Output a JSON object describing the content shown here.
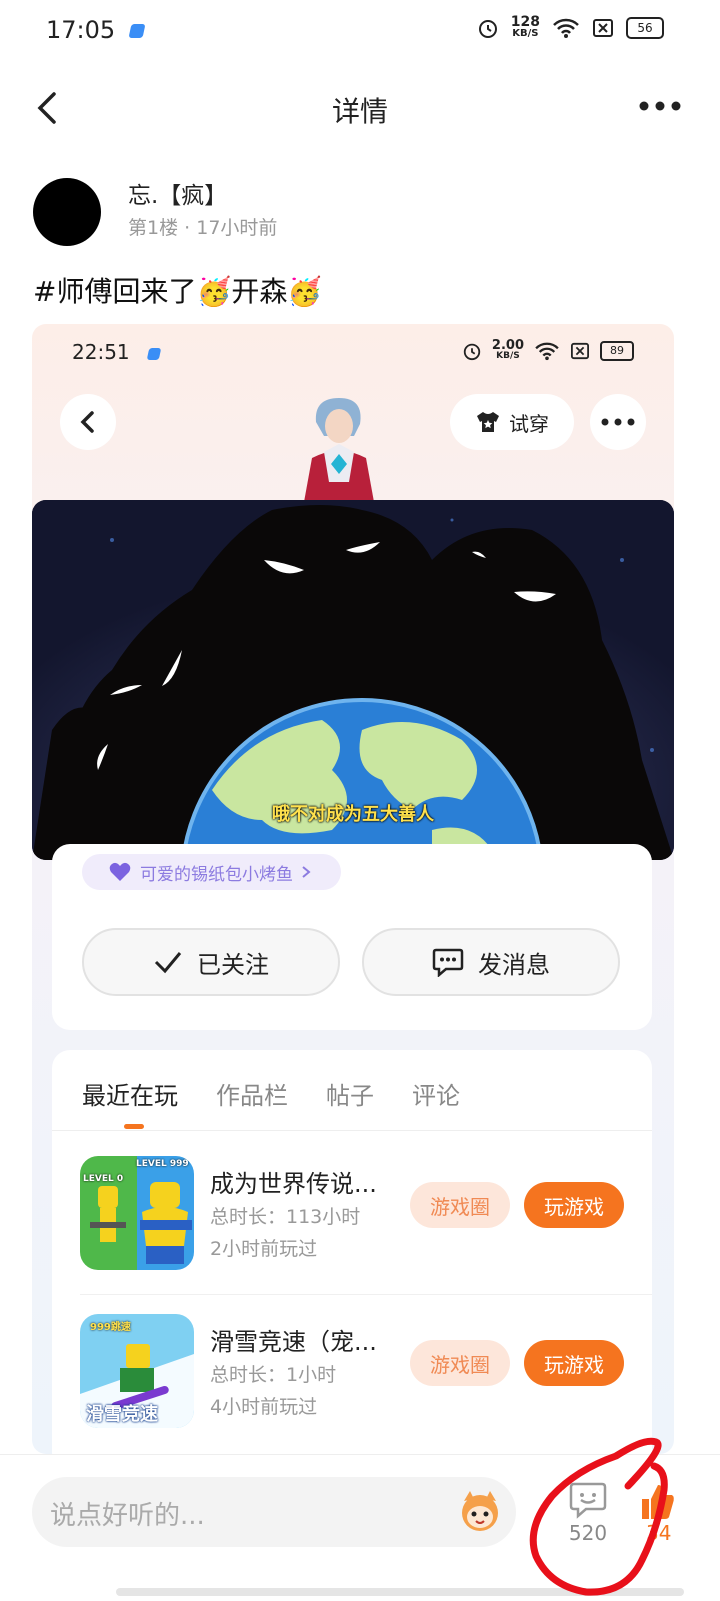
{
  "status_bar": {
    "time": "17:05",
    "net_speed": "128",
    "net_unit": "KB/S",
    "battery": "56"
  },
  "nav": {
    "title": "详情"
  },
  "post": {
    "username": "忘.【疯】",
    "floor": "第1楼",
    "time_ago": "17小时前",
    "text": "#师傅回来了🥳开森🥳"
  },
  "embedded": {
    "status_bar": {
      "time": "22:51",
      "net_speed": "2.00",
      "net_unit": "KB/S",
      "battery": "89"
    },
    "try_on_label": "试穿",
    "video_subtitle": "哦不对成为五大善人",
    "tag_label": "可爱的锡纸包小烤鱼",
    "follow_label": "已关注",
    "message_label": "发消息",
    "tabs": [
      {
        "label": "最近在玩"
      },
      {
        "label": "作品栏"
      },
      {
        "label": "帖子"
      },
      {
        "label": "评论"
      }
    ],
    "games": [
      {
        "name": "成为世界传说...",
        "duration": "总时长：113小时",
        "last_played": "2小时前玩过",
        "circle_label": "游戏圈",
        "play_label": "玩游戏",
        "icon_text_left": "LEVEL 0",
        "icon_text_right": "LEVEL 999"
      },
      {
        "name": "滑雪竞速（宠...",
        "duration": "总时长：1小时",
        "last_played": "4小时前玩过",
        "circle_label": "游戏圈",
        "play_label": "玩游戏",
        "icon_text_top": "999跳速",
        "icon_text_bottom": "滑雪竞速"
      }
    ]
  },
  "bottom_bar": {
    "placeholder": "说点好听的...",
    "comment_count": "520",
    "like_count": "34"
  },
  "colors": {
    "accent": "#f5741f",
    "accent_light": "#fde6da",
    "tag_purple": "#8c7be0",
    "annotation_red": "#e8101a"
  }
}
